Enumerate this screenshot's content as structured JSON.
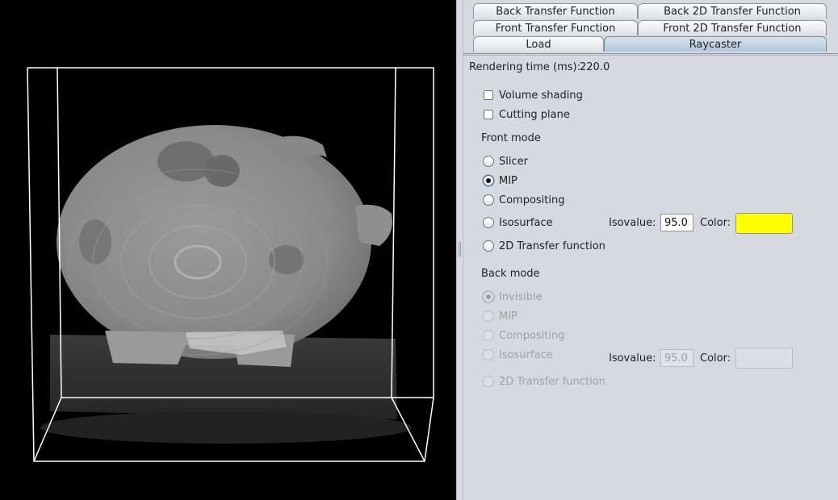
{
  "tabs": {
    "back_transfer_function": "Back Transfer Function",
    "back_2d_transfer_function": "Back 2D Transfer Function",
    "front_transfer_function": "Front Transfer Function",
    "front_2d_transfer_function": "Front 2D Transfer Function",
    "load": "Load",
    "raycaster": "Raycaster",
    "active": "Raycaster"
  },
  "rendering_time": {
    "label": "Rendering time (ms):",
    "value": "220.0"
  },
  "options": {
    "volume_shading": {
      "label": "Volume shading",
      "checked": false
    },
    "cutting_plane": {
      "label": "Cutting plane",
      "checked": false
    }
  },
  "front_mode": {
    "heading": "Front mode",
    "slicer": "Slicer",
    "mip": "MIP",
    "compositing": "Compositing",
    "isosurface": "Isosurface",
    "tf2d": "2D Transfer function",
    "selected": "MIP",
    "isovalue_label": "Isovalue:",
    "isovalue": "95.0",
    "color_label": "Color:",
    "color": "#ffff00"
  },
  "back_mode": {
    "heading": "Back mode",
    "invisible": "Invisible",
    "mip": "MIP",
    "compositing": "Compositing",
    "isosurface": "Isosurface",
    "tf2d": "2D Transfer function",
    "selected": "Invisible",
    "enabled": false,
    "isovalue_label": "Isovalue:",
    "isovalue": "95.0",
    "color_label": "Color:",
    "color": "#dcdfe3"
  },
  "colors": {
    "viewport_bg": "#000000",
    "bounding_box": "#ffffff",
    "panel_bg": "#d6d9df",
    "active_tab": "#b3c6d8"
  }
}
